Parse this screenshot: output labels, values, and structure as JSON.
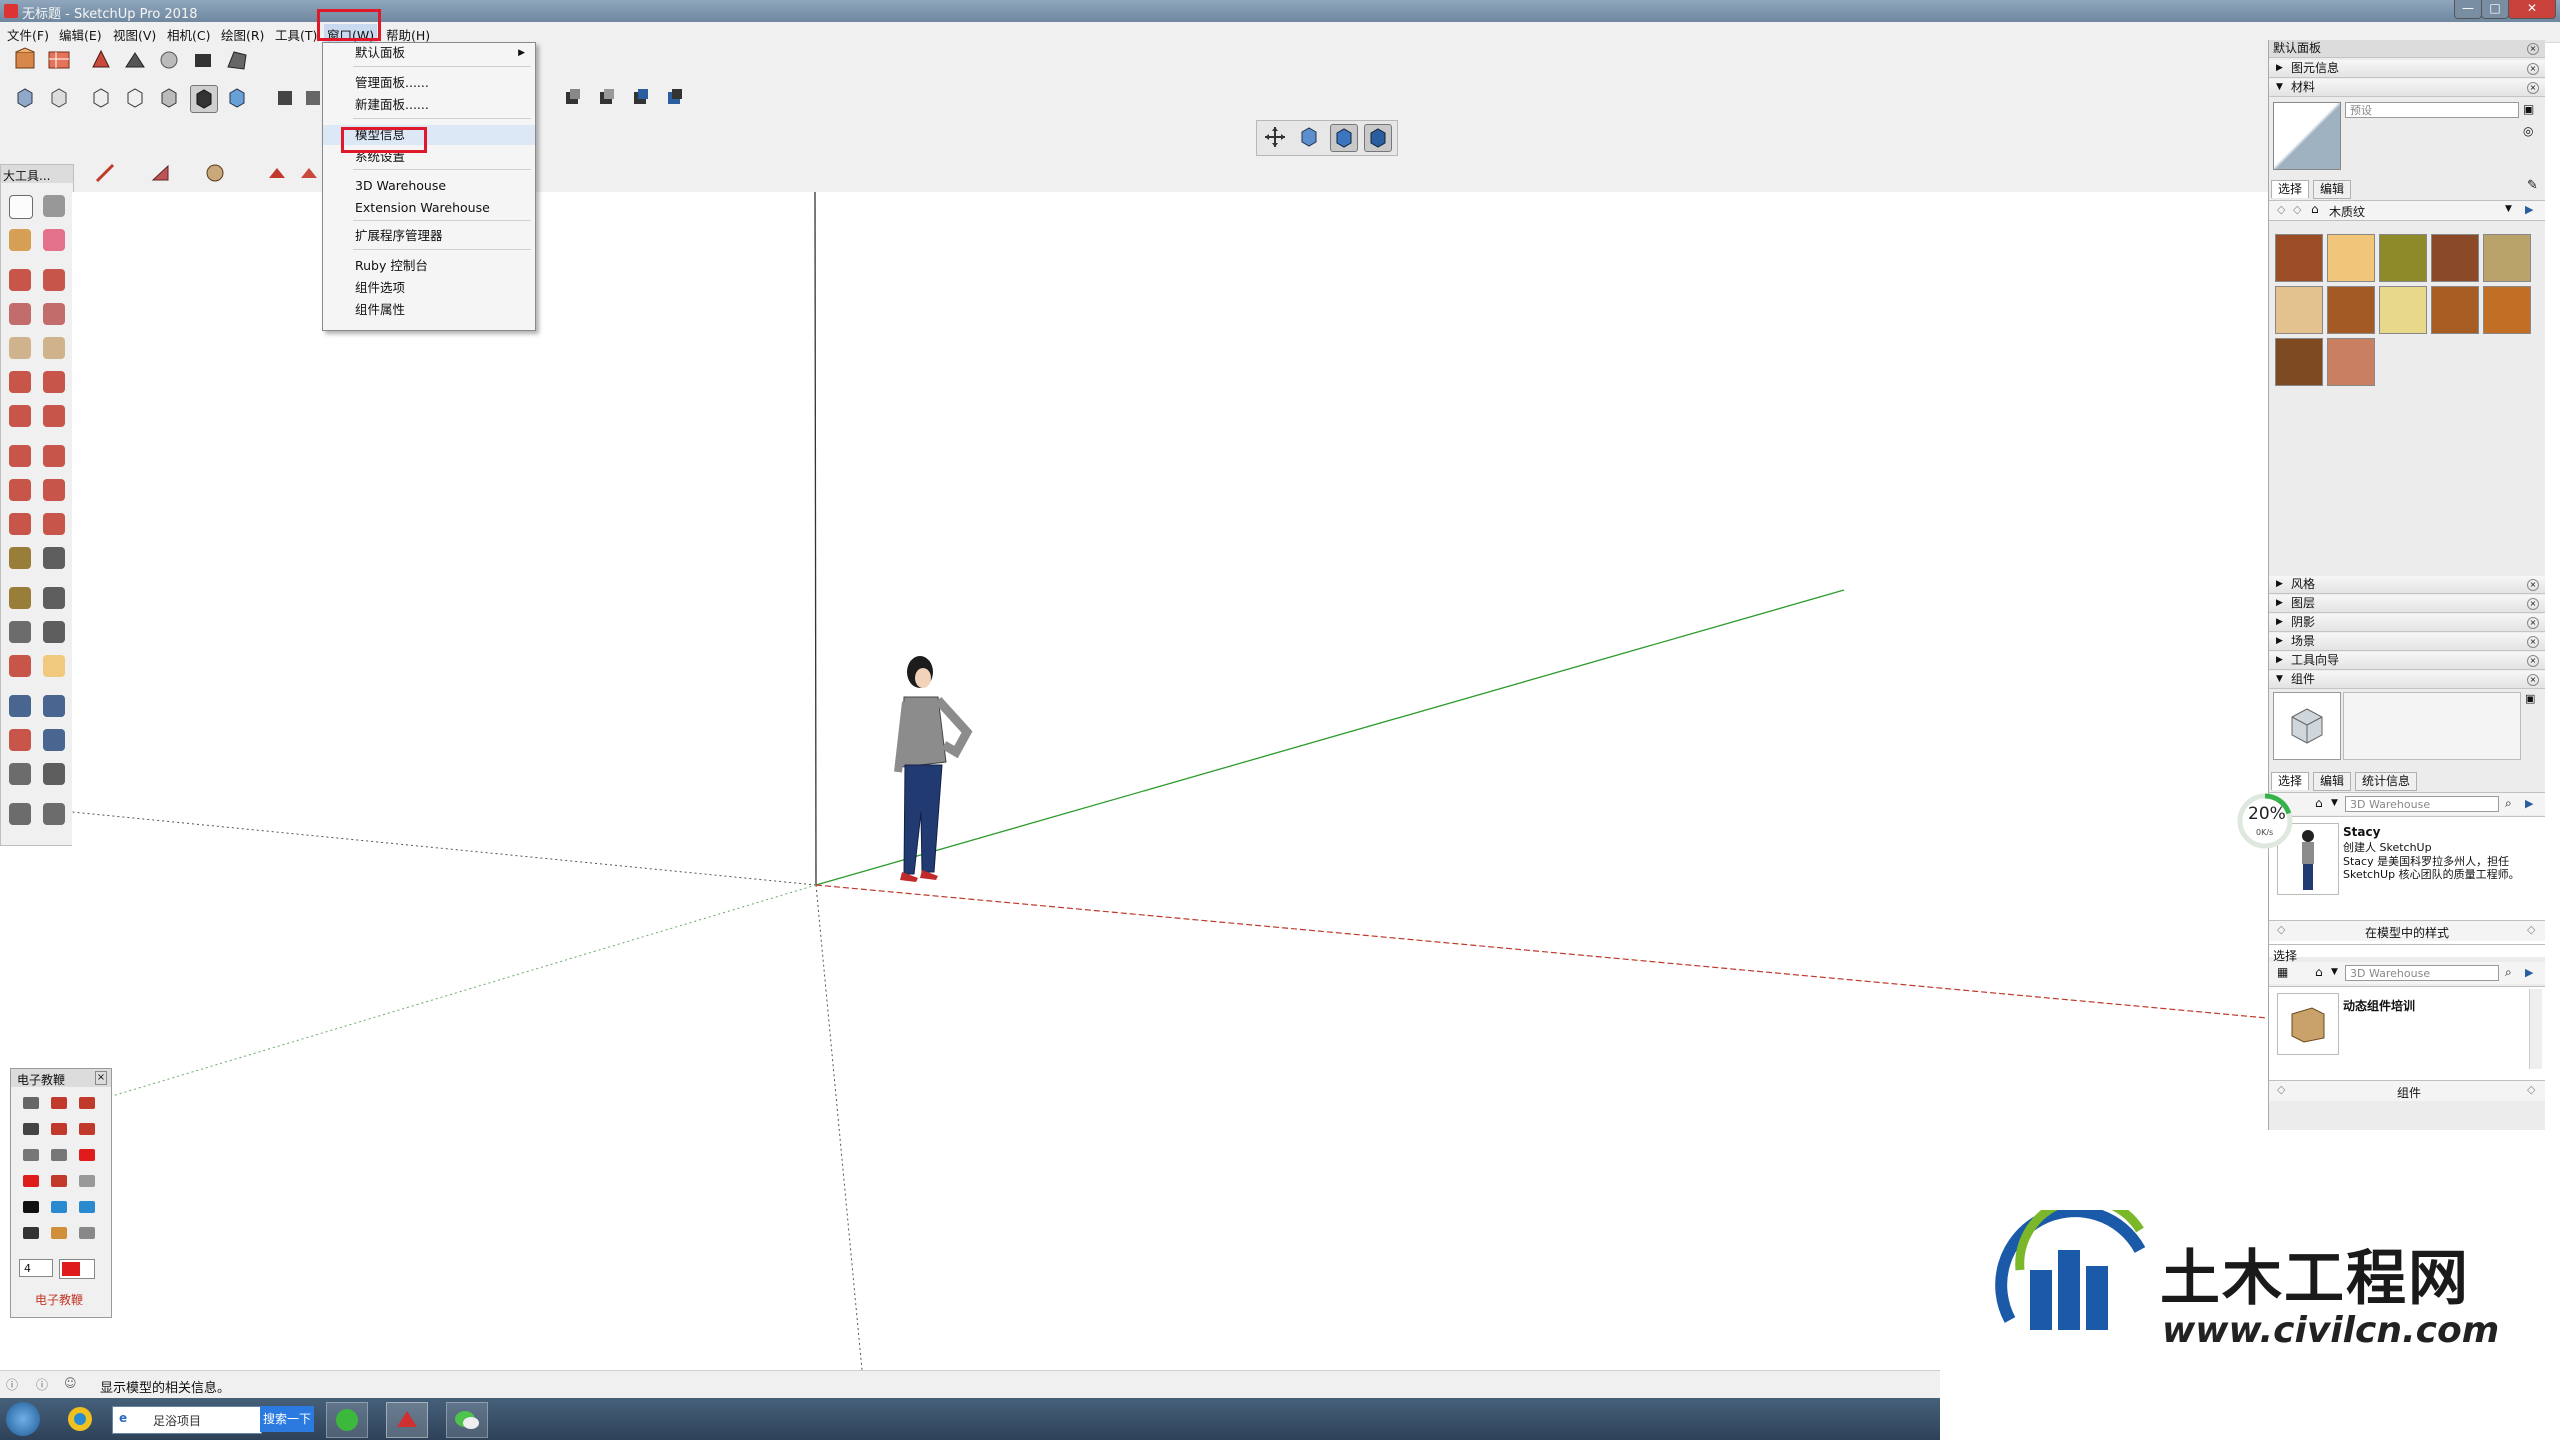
{
  "window": {
    "title": "无标题 - SketchUp Pro 2018",
    "controls": [
      "—",
      "□",
      "✕"
    ]
  },
  "menubar": {
    "items": [
      "文件(F)",
      "编辑(E)",
      "视图(V)",
      "相机(C)",
      "绘图(R)",
      "工具(T)",
      "窗口(W)",
      "帮助(H)"
    ],
    "active_index": 6
  },
  "window_menu": {
    "items": [
      {
        "label": "默认面板",
        "submenu": true
      },
      {
        "label": "管理面板......"
      },
      {
        "label": "新建面板......"
      },
      {
        "label": "模型信息",
        "highlighted": true
      },
      {
        "label": "系统设置"
      },
      {
        "label": "3D Warehouse"
      },
      {
        "label": "Extension Warehouse"
      },
      {
        "label": "扩展程序管理器"
      },
      {
        "label": "Ruby 控制台"
      },
      {
        "label": "组件选项"
      },
      {
        "label": "组件属性"
      }
    ]
  },
  "left_toolbar": {
    "title": "大工具..."
  },
  "tray": {
    "title": "默认面板",
    "entity_info": "图元信息",
    "materials": {
      "title": "材料",
      "name_placeholder": "预设",
      "tab_select": "选择",
      "tab_edit": "编辑",
      "library": "木质纹",
      "swatch_colors": [
        "#9b4e25",
        "#f1c57a",
        "#8e8a2a",
        "#8a4a28",
        "#b9a36a",
        "#e3c28f",
        "#a35a24",
        "#e7d88c",
        "#a85e22",
        "#c26f26",
        "#7e4a22",
        "#c98061"
      ]
    },
    "collapsed": [
      "风格",
      "图层",
      "阴影",
      "场景",
      "工具向导"
    ],
    "components": {
      "title": "组件",
      "tab_select": "选择",
      "tab_edit": "编辑",
      "tab_stats": "统计信息",
      "search_placeholder": "3D Warehouse",
      "item_name": "Stacy",
      "item_desc1": "创建人 SketchUp",
      "item_desc2": "Stacy 是美国科罗拉多州人，担任",
      "item_desc3": "SketchUp 核心团队的质量工程师。",
      "nav_label": "在模型中的样式"
    },
    "secondary": {
      "select_label": "选择",
      "search_placeholder": "3D Warehouse",
      "item_name": "动态组件培训",
      "nav_label": "组件"
    }
  },
  "progress": {
    "percent_text": "20%",
    "rate_text": "0K/s",
    "value": 0.2
  },
  "edu_panel": {
    "title": "电子教鞭",
    "size_value": "4",
    "footer": "电子教鞭"
  },
  "status": {
    "hint": "显示模型的相关信息。"
  },
  "taskbar": {
    "search_text": "足浴项目",
    "search_button": "搜索一下"
  },
  "watermark": {
    "name": "土木工程网",
    "url": "www.civilcn.com"
  },
  "colors": {
    "red_axis": "#c0392b",
    "green_axis": "#2e9b2e",
    "highlight_box": "#e0192a"
  }
}
